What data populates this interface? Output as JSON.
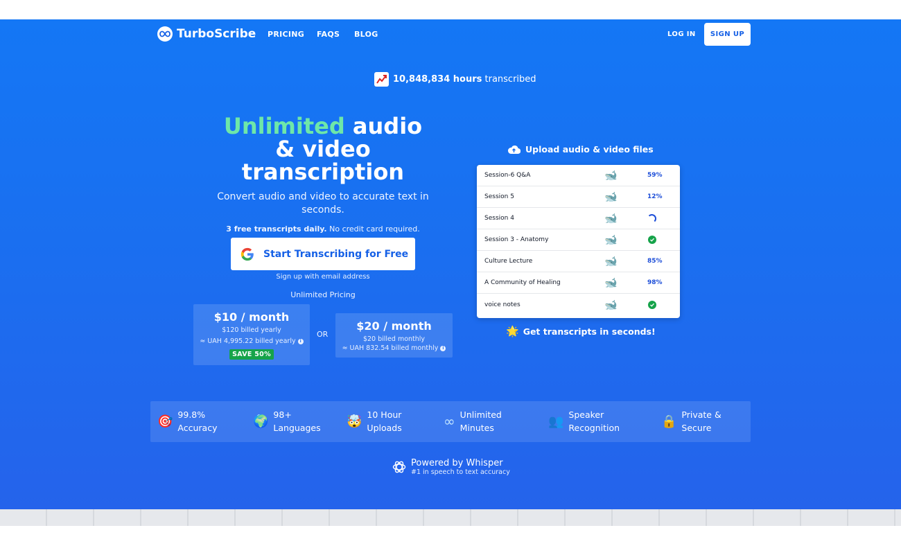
{
  "nav": {
    "brand": "TurboScribe",
    "links": [
      "PRICING",
      "FAQS",
      "BLOG"
    ],
    "login": "LOG IN",
    "signup": "SIGN UP"
  },
  "stat": {
    "count": "10,848,834 hours",
    "suffix": "transcribed",
    "icon": "chart-increasing-icon"
  },
  "hero": {
    "headline_highlight": "Unlimited",
    "headline_line1_rest": " audio",
    "headline_line2": "& video",
    "headline_line3": "transcription",
    "subtitle": "Convert audio and video to accurate text in seconds.",
    "free_bold": "3 free transcripts daily.",
    "free_rest": " No credit card required.",
    "cta_label": "Start Transcribing for Free",
    "email_note": "Sign up with email address",
    "pricing_label": "Unlimited Pricing",
    "or": "OR"
  },
  "plans": [
    {
      "amount": "$10 / month",
      "billed": "$120 billed yearly",
      "local": "≈ UAH 4,995.22 billed yearly",
      "badge": "SAVE 50%"
    },
    {
      "amount": "$20 / month",
      "billed": "$20 billed monthly",
      "local": "≈ UAH 832.54 billed monthly"
    }
  ],
  "upload": {
    "title": "Upload audio & video files",
    "files": [
      {
        "name": "Session-6 Q&A",
        "status": "59%",
        "state": "progress"
      },
      {
        "name": "Session 5",
        "status": "12%",
        "state": "progress"
      },
      {
        "name": "Session 4",
        "status": "",
        "state": "loading"
      },
      {
        "name": "Session 3 - Anatomy",
        "status": "",
        "state": "done"
      },
      {
        "name": "Culture Lecture",
        "status": "85%",
        "state": "progress"
      },
      {
        "name": "A Community of Healing",
        "status": "98%",
        "state": "progress"
      },
      {
        "name": "voice notes",
        "status": "",
        "state": "done"
      }
    ],
    "footer": "Get transcripts in seconds!"
  },
  "features": [
    {
      "icon": "🎯",
      "line1": "99.8%",
      "line2": "Accuracy"
    },
    {
      "icon": "🌍",
      "line1": "98+",
      "line2": "Languages"
    },
    {
      "icon": "🤯",
      "line1": "10 Hour",
      "line2": "Uploads"
    },
    {
      "icon": "∞",
      "line1": "Unlimited",
      "line2": "Minutes"
    },
    {
      "icon": "👥",
      "line1": "Speaker",
      "line2": "Recognition"
    },
    {
      "icon": "🔒",
      "line1": "Private &",
      "line2": "Secure"
    }
  ],
  "powered": {
    "title": "Powered by Whisper",
    "subtitle": "#1 in speech to text accuracy"
  },
  "colors": {
    "hero_top": "#1477f5",
    "hero_bottom": "#2563eb",
    "accent_green": "#6ee7a8",
    "cta_text": "#1560e6",
    "save_badge": "#16a34a"
  }
}
